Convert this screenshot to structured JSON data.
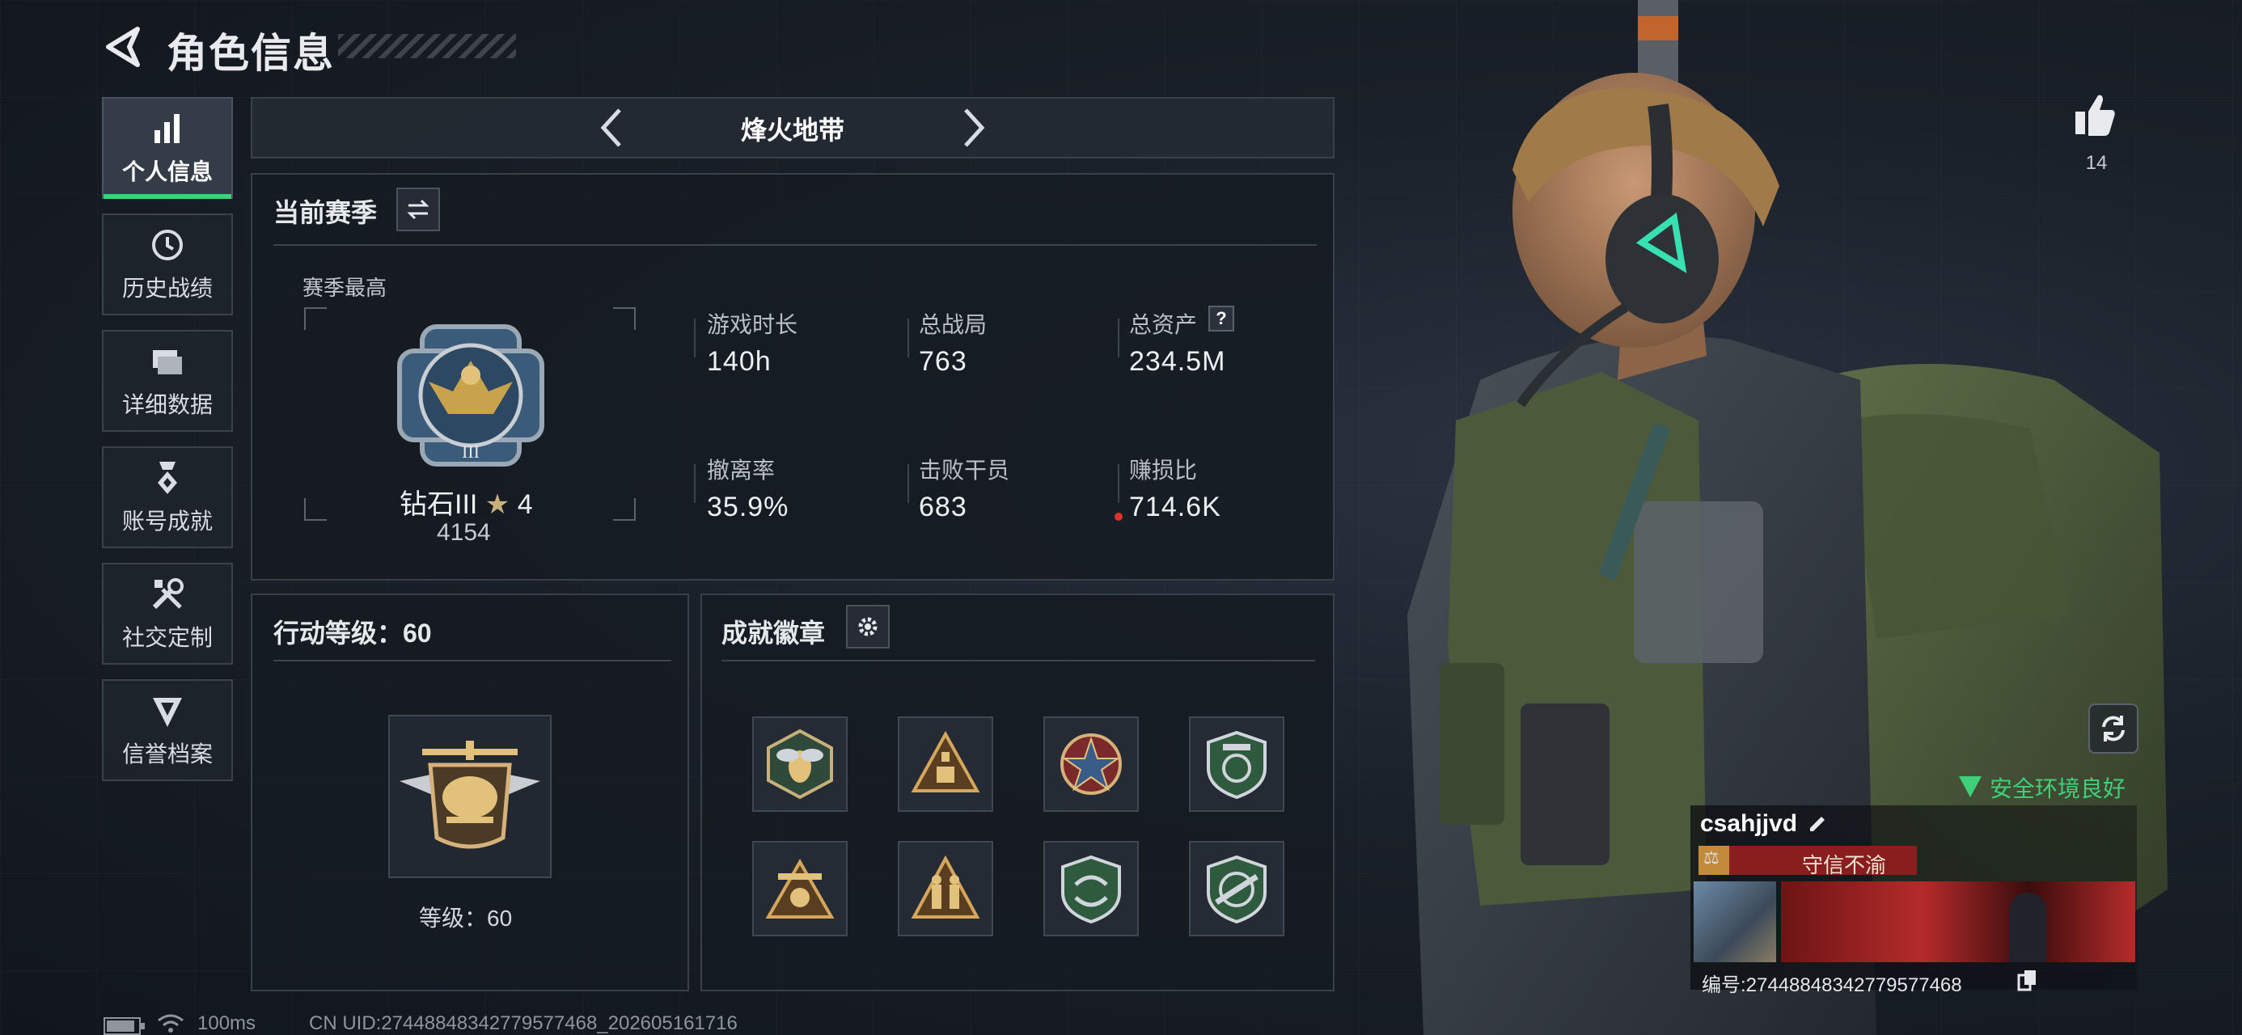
{
  "header": {
    "title": "角色信息"
  },
  "nav": [
    {
      "label": "个人信息",
      "icon": "bar-chart-icon",
      "active": true
    },
    {
      "label": "历史战绩",
      "icon": "history-clock-icon"
    },
    {
      "label": "详细数据",
      "icon": "folder-icon"
    },
    {
      "label": "账号成就",
      "icon": "medal-icon"
    },
    {
      "label": "社交定制",
      "icon": "tools-icon"
    },
    {
      "label": "信誉档案",
      "icon": "shield-badge-icon"
    }
  ],
  "mode": {
    "name": "烽火地带"
  },
  "season": {
    "title": "当前赛季",
    "best_label": "赛季最高",
    "rank_name": "钻石III",
    "rank_stars": "4",
    "rank_score": "4154",
    "stats": [
      {
        "label": "游戏时长",
        "value": "140h"
      },
      {
        "label": "总战局",
        "value": "763"
      },
      {
        "label": "总资产",
        "value": "234.5M"
      },
      {
        "label": "撤离率",
        "value": "35.9%"
      },
      {
        "label": "击败干员",
        "value": "683"
      },
      {
        "label": "赚损比",
        "value": "714.6K"
      }
    ],
    "help_icon_text": "?"
  },
  "action_level": {
    "title": "行动等级：60",
    "level_text": "等级：60"
  },
  "achievements": {
    "title": "成就徽章",
    "badges": [
      "bee-badge-icon",
      "triangle-box-badge-icon",
      "star-cross-badge-icon",
      "green-shield-badge-icon",
      "eagle-triangle-badge-icon",
      "soldiers-triangle-badge-icon",
      "green-arrows-badge-icon",
      "green-rifle-badge-icon"
    ]
  },
  "likes": {
    "count": "14"
  },
  "profile": {
    "safety_text": "安全环境良好",
    "username": "csahjjvd",
    "reputation": "守信不渝",
    "uid_label": "编号:274488483427795774​68"
  },
  "status": {
    "ping": "100ms",
    "uid_line": "CN UID:274488483427795774​68_202605161716"
  },
  "colors": {
    "accent_green": "#3fd07a",
    "reputation_red": "#8a1d1d"
  }
}
